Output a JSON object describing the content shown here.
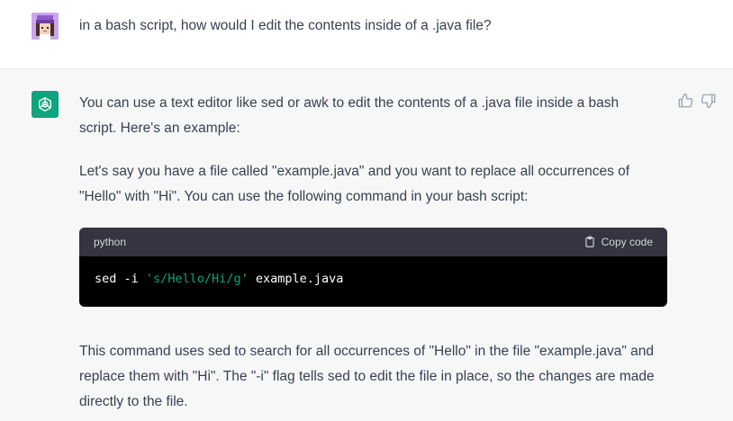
{
  "user": {
    "avatar_icon": "user-avatar-pixel-art",
    "prompt": "in a bash script, how would I edit the contents inside of a .java file?"
  },
  "assistant": {
    "avatar_icon": "openai-logo-icon",
    "avatar_color": "#10a37f",
    "paragraph1": "You can use a text editor like sed or awk to edit the contents of a .java file inside a bash script. Here's an example:",
    "paragraph2": "Let's say you have a file called \"example.java\" and you want to replace all occurrences of \"Hello\" with \"Hi\". You can use the following command in your bash script:",
    "code_block": {
      "language": "python",
      "copy_label": "Copy code",
      "code_cmd": "sed -i ",
      "code_string": "'s/Hello/Hi/g'",
      "code_rest": " example.java"
    },
    "paragraph3": "This command uses sed to search for all occurrences of \"Hello\" in the file \"example.java\" and replace them with \"Hi\". The \"-i\" flag tells sed to edit the file in place, so the changes are made directly to the file.",
    "feedback": {
      "thumbs_up_icon": "thumbs-up-icon",
      "thumbs_down_icon": "thumbs-down-icon"
    }
  }
}
